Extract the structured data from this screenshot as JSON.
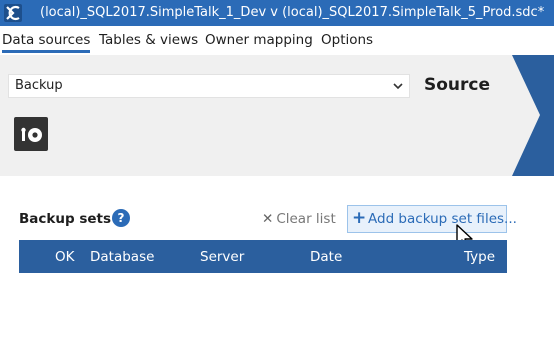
{
  "window": {
    "title": "(local)_SQL2017.SimpleTalk_1_Dev v (local)_SQL2017.SimpleTalk_5_Prod.sdc*",
    "app_icon": "dc-logo-icon"
  },
  "tabs": [
    {
      "label": "Data sources",
      "active": true
    },
    {
      "label": "Tables & views",
      "active": false
    },
    {
      "label": "Owner mapping",
      "active": false
    },
    {
      "label": "Options",
      "active": false
    }
  ],
  "source": {
    "type_select": {
      "value": "Backup"
    },
    "heading": "Source",
    "backup_icon": "backup-disk-icon"
  },
  "backup_sets": {
    "label": "Backup sets",
    "help_icon_text": "?",
    "clear_list": {
      "icon": "x-icon",
      "label": "Clear list"
    },
    "add_button": {
      "icon": "plus-icon",
      "label": "Add backup set files..."
    },
    "columns": [
      "OK",
      "Database",
      "Server",
      "Date",
      "Type"
    ]
  },
  "colors": {
    "accent": "#2b6bb7",
    "table_header": "#2b5f9e",
    "panel_bg": "#f0f0f0"
  }
}
